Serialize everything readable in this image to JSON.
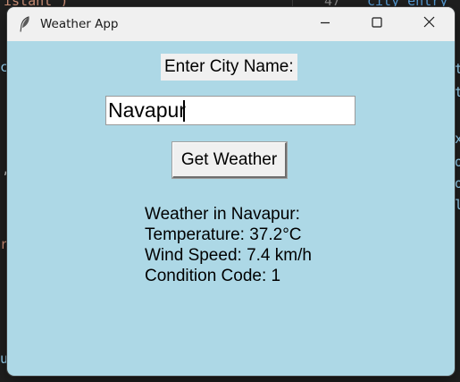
{
  "window": {
    "title": "Weather App"
  },
  "city_label": "Enter City Name:",
  "city_input": {
    "value": "Navapur"
  },
  "get_weather_button": "Get Weather",
  "result": {
    "line1": "Weather in Navapur:",
    "line2": "Temperature: 37.2°C",
    "line3": "Wind Speed: 7.4 km/h",
    "line4": "Condition Code: 1"
  },
  "background_editor": {
    "fragments": [
      "istant\")",
      "47",
      "city_entry",
      "c",
      "t",
      "t",
      "x",
      "o",
      "o",
      "l",
      "r",
      "u",
      ","
    ]
  },
  "colors": {
    "window_bg": "#add8e6",
    "titlebar_bg": "#f0f0f0",
    "label_bg": "#f0f0f0",
    "entry_bg": "#ffffff",
    "editor_bg": "#1f1f1f"
  },
  "icons": [
    "feather-icon",
    "minimize-icon",
    "maximize-icon",
    "close-icon"
  ]
}
